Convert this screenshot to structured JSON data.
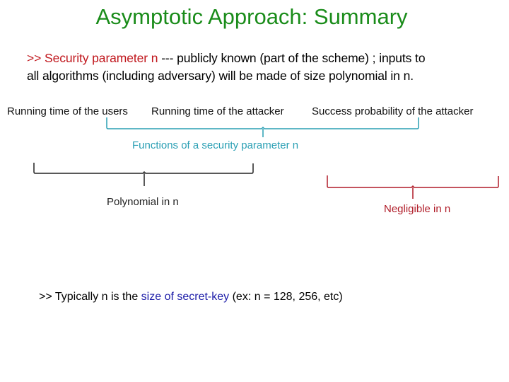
{
  "slide": {
    "title": "Asymptotic Approach: Summary",
    "bullet1": {
      "prefix": ">> Security parameter n",
      "rest": " --- publicly known (part of the scheme) ; inputs to"
    },
    "bullet2": "all algorithms (including adversary) will be made of size polynomial in n.",
    "labels": {
      "users_time": "Running time of the users",
      "attacker_time": "Running time of the attacker",
      "attacker_success": "Success probability of the attacker"
    },
    "functions_label": "Functions of a security parameter n",
    "polynomial_label": "Polynomial in n",
    "negligible_label": "Negligible in n",
    "bottom_note": {
      "prefix": ">> Typically n is the ",
      "highlight": "size of secret-key",
      "suffix": " (ex: n = 128, 256, etc)"
    },
    "colors": {
      "title": "#1a8c1a",
      "security_param": "#c0161c",
      "functions_bracket": "#2a9fb4",
      "polynomial_bracket": "#222222",
      "negligible_bracket": "#b01c28",
      "secret_key": "#1c1ca8"
    }
  }
}
